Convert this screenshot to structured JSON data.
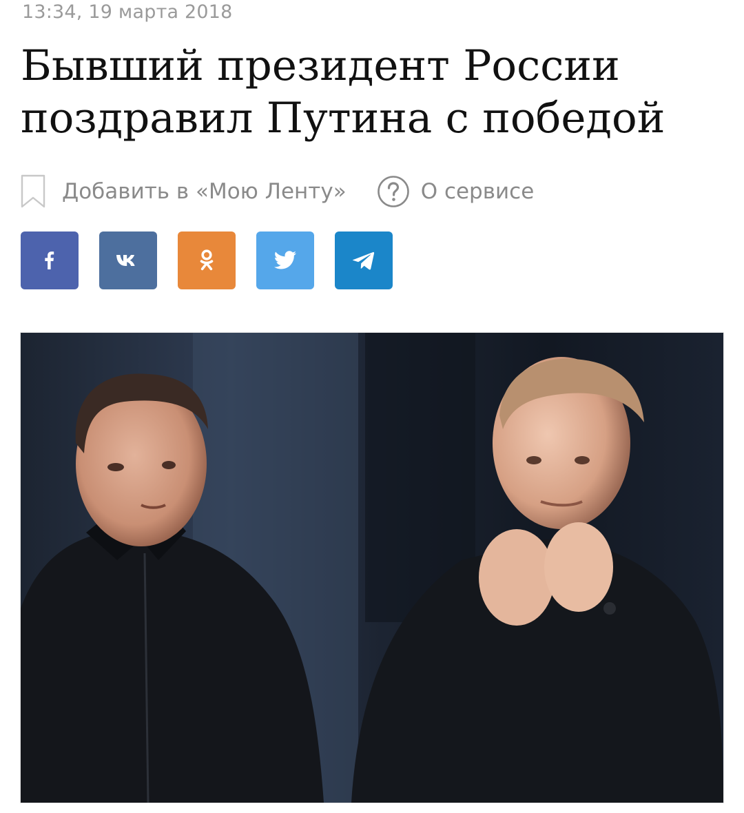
{
  "article": {
    "timestamp": "13:34, 19 марта 2018",
    "title": "Бывший президент России поздравил Путина с победой"
  },
  "actions": {
    "add_feed_label": "Добавить в «Мою Ленту»",
    "about_label": "О сервисе"
  },
  "share": {
    "buttons": [
      {
        "network": "facebook",
        "icon": "facebook-icon",
        "color": "#4d63ad"
      },
      {
        "network": "vkontakte",
        "icon": "vk-icon",
        "color": "#4d6f9e"
      },
      {
        "network": "odnoklassniki",
        "icon": "odnoklassniki-icon",
        "color": "#e8883a"
      },
      {
        "network": "twitter",
        "icon": "twitter-icon",
        "color": "#55a7ea"
      },
      {
        "network": "telegram",
        "icon": "telegram-icon",
        "color": "#1b86c9"
      }
    ]
  },
  "photo": {
    "subject": "two-men-in-dark-coats"
  }
}
